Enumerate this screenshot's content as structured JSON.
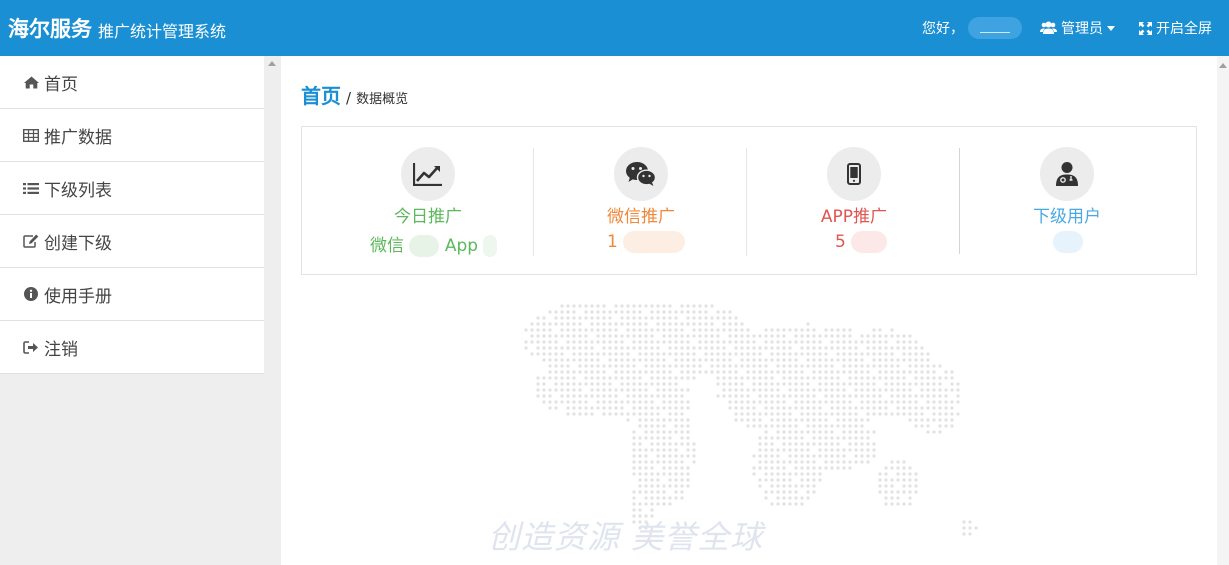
{
  "header": {
    "brand": "海尔服务",
    "subtitle": "推广统计管理系统",
    "greeting": "您好，",
    "admin_label": "管理员",
    "fullscreen_label": "开启全屏"
  },
  "sidebar": {
    "items": [
      {
        "label": "首页",
        "icon": "home-icon"
      },
      {
        "label": "推广数据",
        "icon": "table-icon"
      },
      {
        "label": "下级列表",
        "icon": "list-icon"
      },
      {
        "label": "创建下级",
        "icon": "edit-icon"
      },
      {
        "label": "使用手册",
        "icon": "info-icon"
      },
      {
        "label": "注销",
        "icon": "sign-out-icon"
      }
    ]
  },
  "breadcrumb": {
    "home": "首页",
    "separator": "/",
    "current": "数据概览"
  },
  "stats": [
    {
      "title": "今日推广",
      "icon": "line-chart-icon",
      "color": "#5cb85c",
      "sub_a": "微信",
      "sub_b": "App"
    },
    {
      "title": "微信推广",
      "icon": "wechat-icon",
      "color": "#f0883a",
      "value": "1"
    },
    {
      "title": "APP推广",
      "icon": "mobile-icon",
      "color": "#e0554f",
      "value": "5"
    },
    {
      "title": "下级用户",
      "icon": "user-doctor-icon",
      "color": "#4aa8e0",
      "value": ""
    }
  ],
  "slogan": "创造资源   美誉全球",
  "colors": {
    "topbar": "#1a8fd3",
    "accent": "#1a8fd3"
  }
}
